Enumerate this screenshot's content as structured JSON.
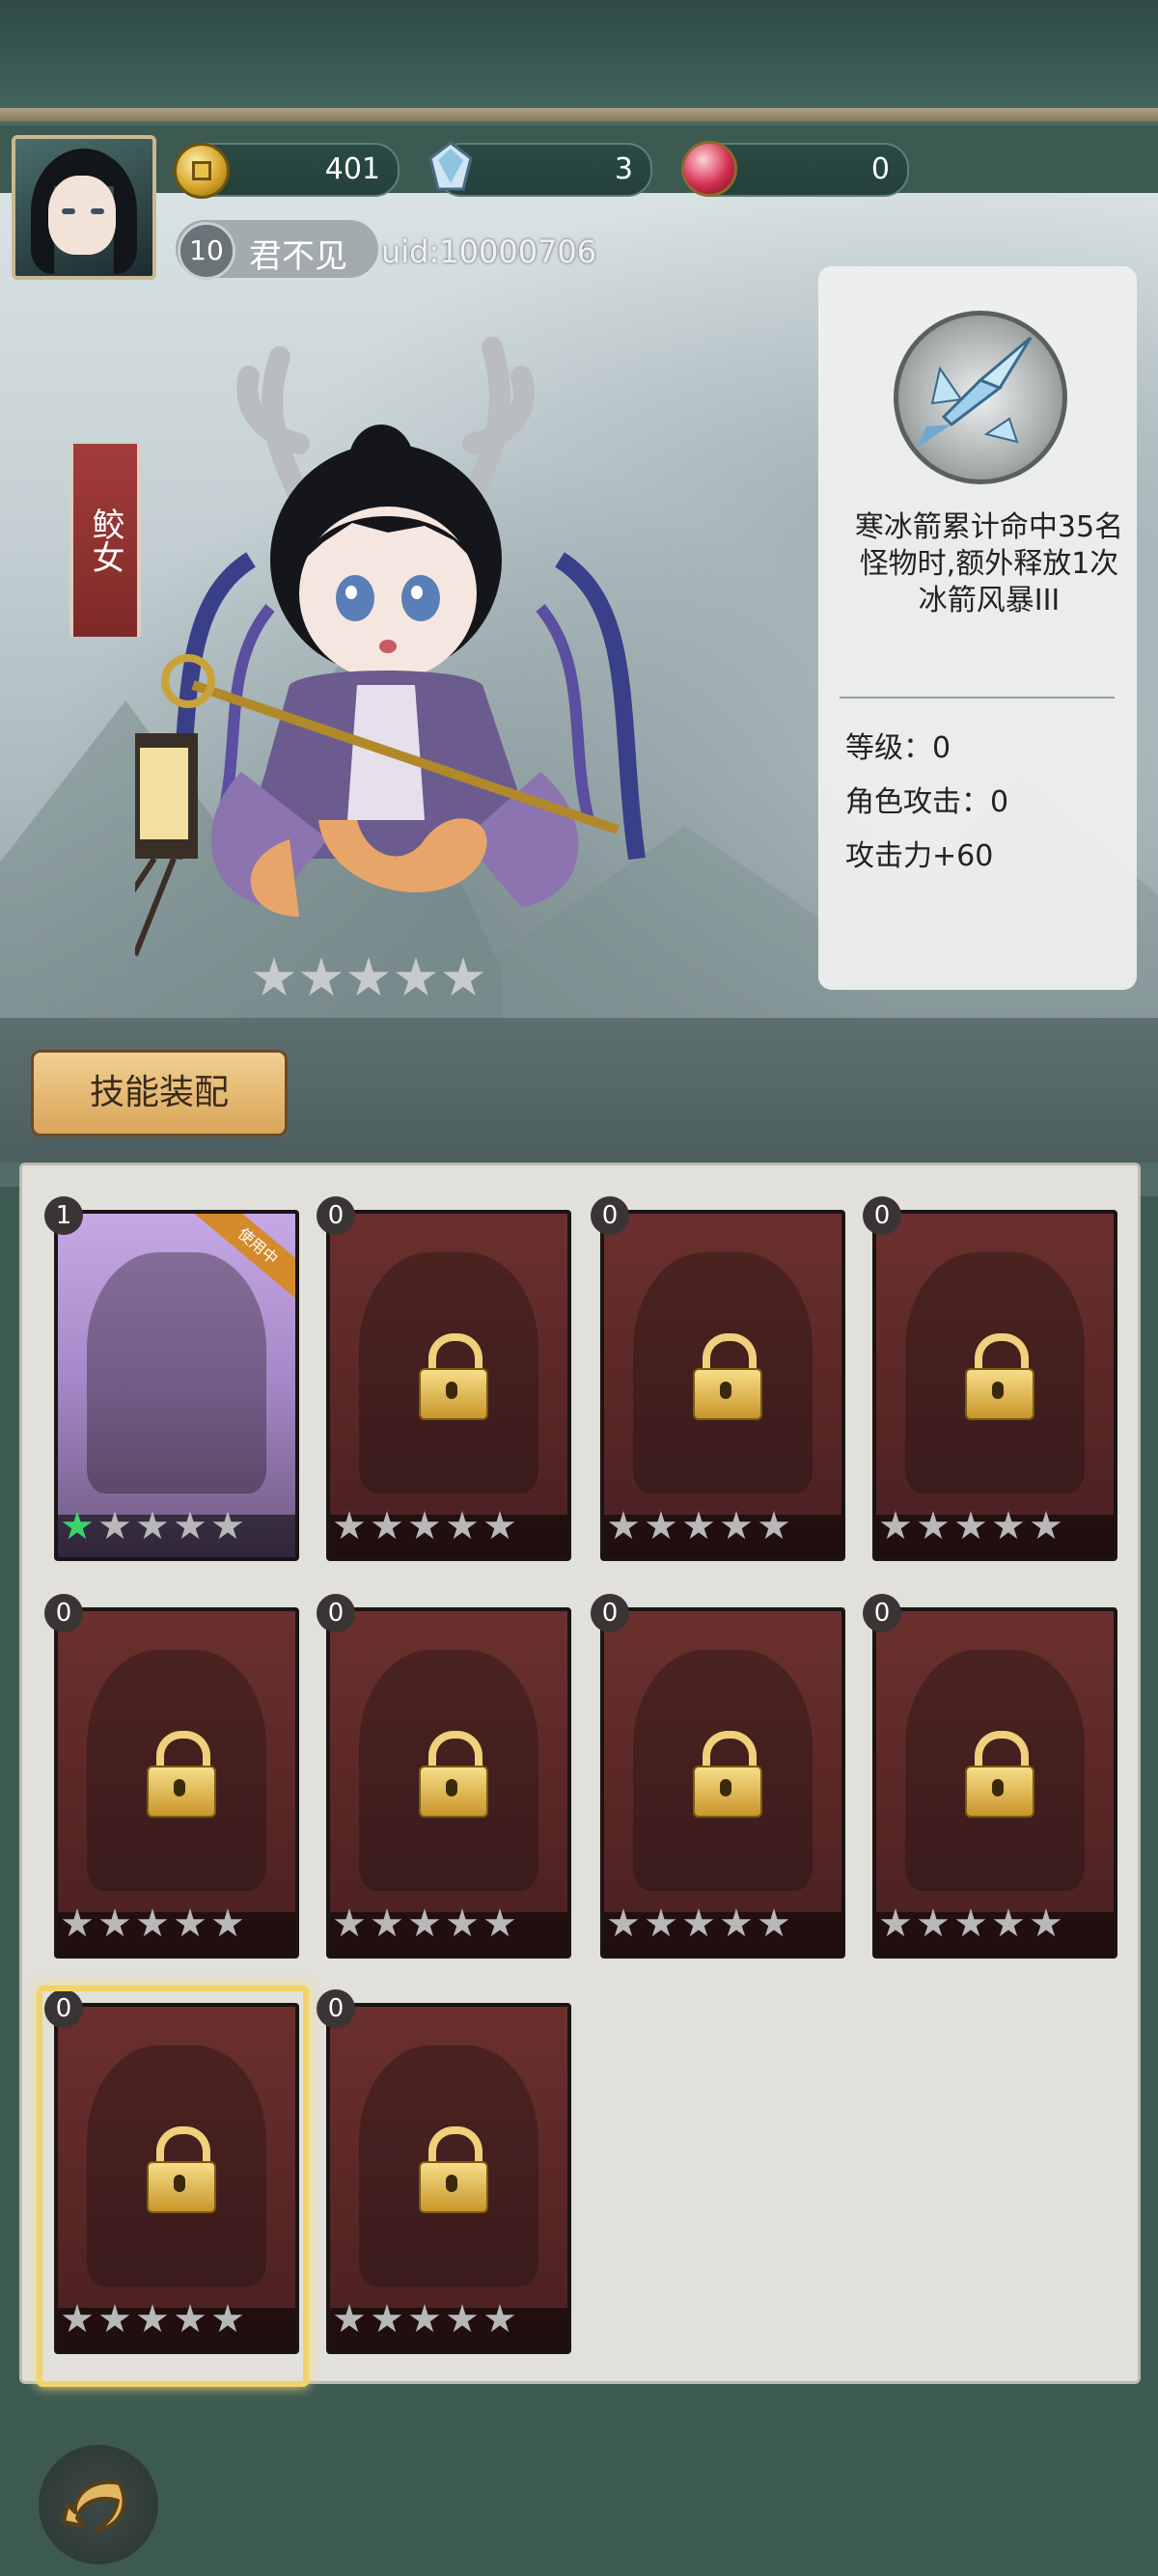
{
  "player": {
    "level": "10",
    "name": "君不见",
    "uid": "uid:10000706"
  },
  "currencies": {
    "coins": "401",
    "crystals": "3",
    "orbs": "0"
  },
  "character": {
    "name": "鲛女",
    "stars": 5,
    "stars_filled": 0
  },
  "skill": {
    "icon": "ice-arrow-icon",
    "description": "寒冰箭累计命中35名怪物时,额外释放1次冰箭风暴III",
    "stats": [
      "等级：0",
      "角色攻击：0",
      "攻击力+60"
    ]
  },
  "equip_button": {
    "label": "技能装配"
  },
  "cards": [
    {
      "count": "1",
      "locked": false,
      "in_use": true,
      "ribbon": "使用中",
      "stars_filled": 1
    },
    {
      "count": "0",
      "locked": true,
      "stars_filled": 0
    },
    {
      "count": "0",
      "locked": true,
      "stars_filled": 0
    },
    {
      "count": "0",
      "locked": true,
      "stars_filled": 0
    },
    {
      "count": "0",
      "locked": true,
      "stars_filled": 0
    },
    {
      "count": "0",
      "locked": true,
      "stars_filled": 0
    },
    {
      "count": "0",
      "locked": true,
      "stars_filled": 0
    },
    {
      "count": "0",
      "locked": true,
      "stars_filled": 0
    },
    {
      "count": "0",
      "locked": true,
      "selected": true,
      "stars_filled": 0
    },
    {
      "count": "0",
      "locked": true,
      "stars_filled": 0
    }
  ],
  "colors": {
    "accent_gold": "#f1d36a",
    "card_red": "#5a2726",
    "banner_red": "#a23d3a",
    "star_green": "#3bd36a"
  }
}
